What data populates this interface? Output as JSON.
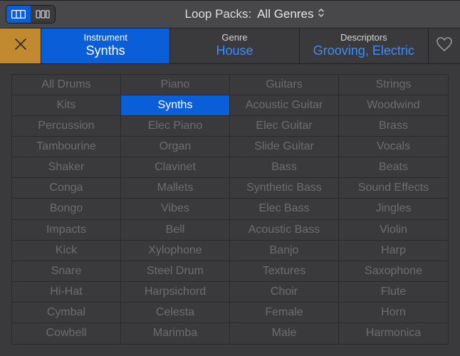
{
  "topbar": {
    "view_modes": [
      "grid",
      "columns"
    ],
    "active_view": 0,
    "loop_packs_label": "Loop Packs:",
    "loop_packs_value": "All Genres"
  },
  "filters": {
    "close_icon": "close-icon",
    "tabs": [
      {
        "category": "Instrument",
        "value": "Synths",
        "active": true
      },
      {
        "category": "Genre",
        "value": "House",
        "active": false
      },
      {
        "category": "Descriptors",
        "value": "Grooving, Electric",
        "active": false
      }
    ],
    "favorite_icon": "heart-icon"
  },
  "grid": {
    "columns": [
      [
        "All Drums",
        "Kits",
        "Percussion",
        "Tambourine",
        "Shaker",
        "Conga",
        "Bongo",
        "Impacts",
        "Kick",
        "Snare",
        "Hi-Hat",
        "Cymbal",
        "Cowbell"
      ],
      [
        "Piano",
        "Synths",
        "Elec Piano",
        "Organ",
        "Clavinet",
        "Mallets",
        "Vibes",
        "Bell",
        "Xylophone",
        "Steel Drum",
        "Harpsichord",
        "Celesta",
        "Marimba"
      ],
      [
        "Guitars",
        "Acoustic Guitar",
        "Elec Guitar",
        "Slide Guitar",
        "Bass",
        "Synthetic Bass",
        "Elec Bass",
        "Acoustic Bass",
        "Banjo",
        "Textures",
        "Choir",
        "Female",
        "Male"
      ],
      [
        "Strings",
        "Woodwind",
        "Brass",
        "Vocals",
        "Beats",
        "Sound Effects",
        "Jingles",
        "Violin",
        "Harp",
        "Saxophone",
        "Flute",
        "Horn",
        "Harmonica"
      ]
    ],
    "selected": "Synths"
  },
  "colors": {
    "accent": "#0a5ed8",
    "close_bg": "#c28a30",
    "link": "#3a8cff"
  }
}
